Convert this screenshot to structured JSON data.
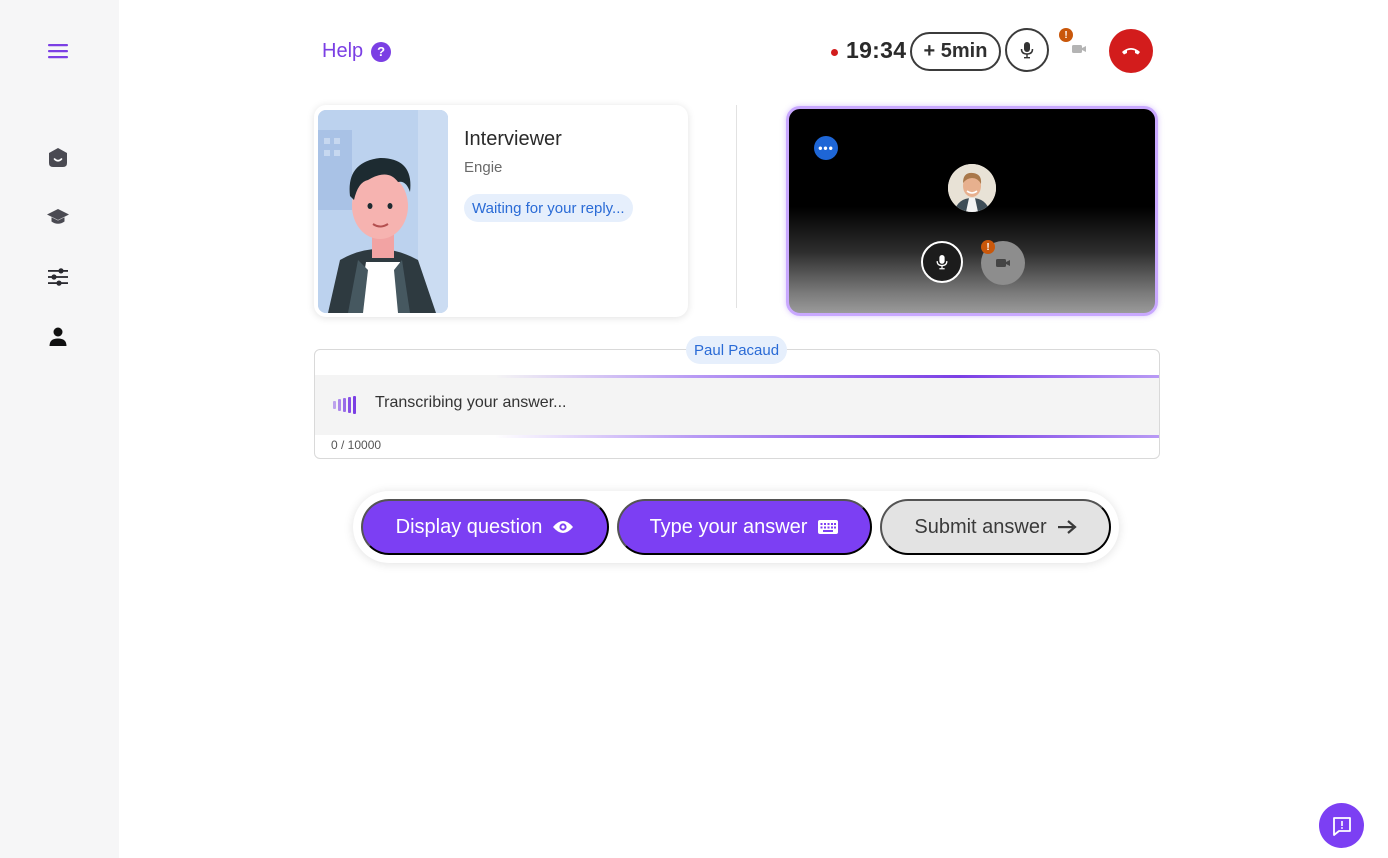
{
  "sidebar": {
    "menu_icon": "menu-icon",
    "items": [
      {
        "name": "home",
        "icon": "home-icon"
      },
      {
        "name": "learning",
        "icon": "graduation-cap-icon"
      },
      {
        "name": "settings",
        "icon": "sliders-icon"
      },
      {
        "name": "profile",
        "icon": "user-icon"
      }
    ]
  },
  "header": {
    "help_label": "Help",
    "help_icon_text": "?",
    "timer": "19:34",
    "add_time_label": "+ 5min",
    "warning_text": "!"
  },
  "interviewer": {
    "title": "Interviewer",
    "company": "Engie",
    "status": "Waiting for your reply..."
  },
  "self_video": {
    "more_label": "•••",
    "warning_text": "!"
  },
  "transcript": {
    "speaker": "Paul Pacaud",
    "status_text": "Transcribing your answer...",
    "char_count": "0 / 10000"
  },
  "actions": {
    "display_question": "Display question",
    "type_answer": "Type your answer",
    "submit_answer": "Submit answer"
  },
  "colors": {
    "accent": "#7c3ff3",
    "hangup": "#d31c1c",
    "status_blue": "#2a6bd6",
    "warning": "#c9570a"
  }
}
